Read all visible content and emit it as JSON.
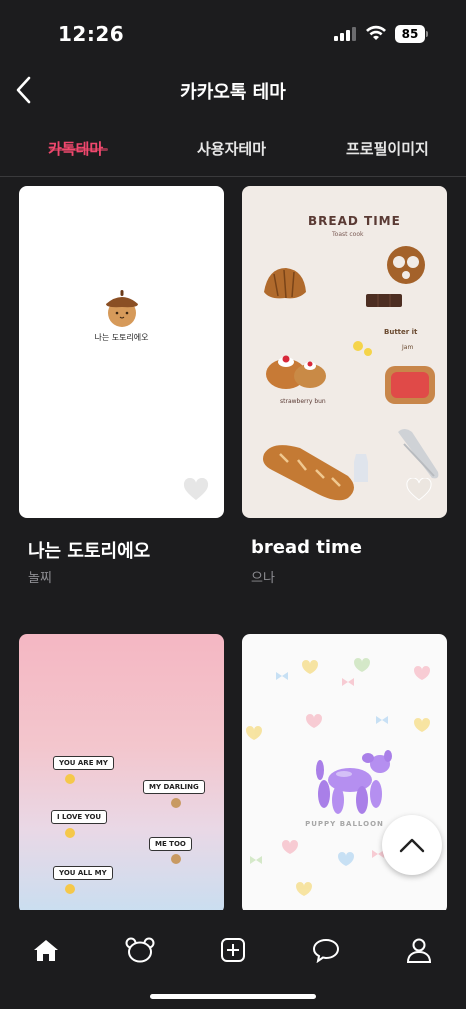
{
  "status": {
    "time": "12:26",
    "battery": "85"
  },
  "header": {
    "title": "카카오톡 테마"
  },
  "tabs": [
    {
      "label": "카톡테마",
      "active": true
    },
    {
      "label": "사용자테마",
      "active": false
    },
    {
      "label": "프로필이미지",
      "active": false
    }
  ],
  "themes": [
    {
      "title": "나는 도토리에오",
      "author": "놀찌",
      "preview_text": "나는 도토리에오"
    },
    {
      "title": "bread time",
      "author": "으나",
      "preview_title": "BREAD TIME",
      "preview_subtitle": "Toast cook",
      "preview_labels": [
        "Butter it",
        "Jam",
        "strawberry bun"
      ]
    },
    {
      "bubbles": [
        "YOU ARE MY",
        "MY DARLING",
        "I LOVE YOU",
        "ME TOO",
        "YOU ALL MY"
      ]
    },
    {
      "preview_text": "PUPPY BALLOON"
    }
  ],
  "nav": [
    "home",
    "bear",
    "add",
    "chat",
    "profile"
  ],
  "colors": {
    "accent": "#f0486e",
    "background": "#1c1c1e"
  }
}
